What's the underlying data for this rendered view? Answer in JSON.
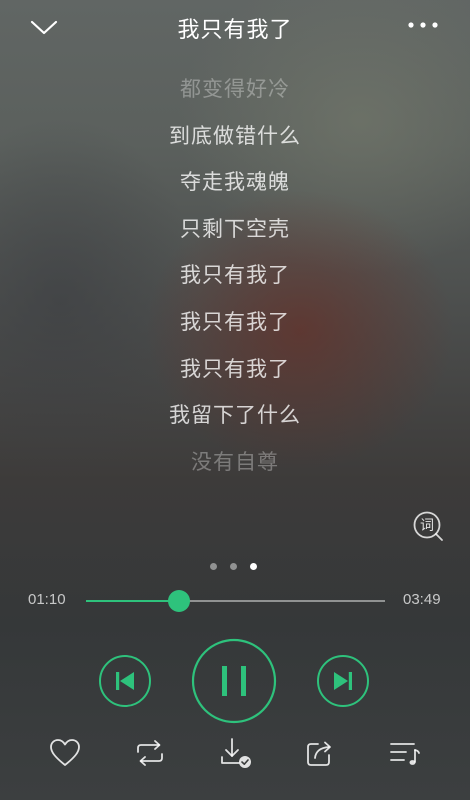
{
  "header": {
    "title": "我只有我了",
    "back_icon": "chevron-down-icon",
    "more_icon": "more-dots-icon"
  },
  "lyrics": [
    {
      "text": "都变得好冷",
      "faded": true
    },
    {
      "text": "到底做错什么",
      "faded": false
    },
    {
      "text": "夺走我魂魄",
      "faded": false
    },
    {
      "text": "只剩下空壳",
      "faded": false
    },
    {
      "text": "我只有我了",
      "faded": false
    },
    {
      "text": "我只有我了",
      "faded": false
    },
    {
      "text": "我只有我了",
      "faded": false
    },
    {
      "text": "我留下了什么",
      "faded": false
    },
    {
      "text": "没有自尊",
      "faded": true
    }
  ],
  "lyric_mode": {
    "label": "词"
  },
  "pager": {
    "count": 3,
    "active": 2
  },
  "player": {
    "current_time": "01:10",
    "total_time": "03:49",
    "progress": 0.31,
    "accent": "#2ec27c"
  },
  "bottom_bar": {
    "icons": [
      "heart-icon",
      "repeat-icon",
      "download-icon",
      "share-icon",
      "playlist-icon"
    ]
  }
}
